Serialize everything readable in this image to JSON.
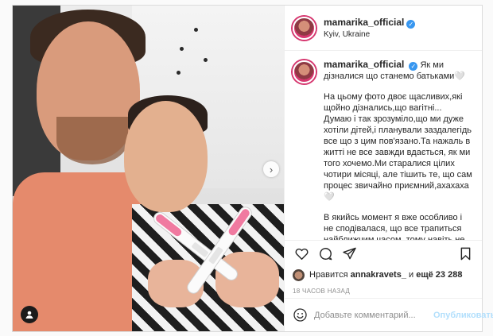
{
  "post": {
    "username": "mamarika_official",
    "verified_mark": "✓",
    "location": "Kyiv, Ukraine"
  },
  "caption": {
    "username": "mamarika_official",
    "title": "Як ми дізналися що станемо батьками🤍",
    "paragraphs": [
      "На цьому фото двоє щасливих,які щойно дізнались,що вагітні...",
      "Думаю і так зрозуміло,що ми дуже хотіли дітей,і планували заздалегідь все що з цим пов'язано.Та нажаль в житті не все завжди вдається, як ми того хочемо.Ми старалися цілих чотири місяці, але тішить те, що сам процес звичайно приємний,ахахаха🤍",
      "В якийсь момент я вже особливо і не сподівалася, що все трапиться найближчим часом, тому навіть не підозрювала що вже була при"
    ]
  },
  "icons": {
    "like": "heart-icon",
    "comment": "comment-bubble-icon",
    "share": "send-paper-plane-icon",
    "save": "bookmark-icon",
    "emoji": "smiley-icon",
    "next": "chevron-right-icon",
    "tags": "user-tag-icon"
  },
  "likes": {
    "prefix": "Нравится",
    "user": "annakravets_",
    "middle": "и",
    "rest": "ещё 23 288"
  },
  "timestamp": "18 ЧАСОВ НАЗАД",
  "comment_box": {
    "placeholder": "Добавьте комментарий...",
    "post_label": "Опубликовать"
  },
  "media": {
    "next_arrow": "›"
  },
  "colors": {
    "accent": "#3897f0",
    "post_disabled": "#b2dffc",
    "border": "#dbdbdb"
  }
}
